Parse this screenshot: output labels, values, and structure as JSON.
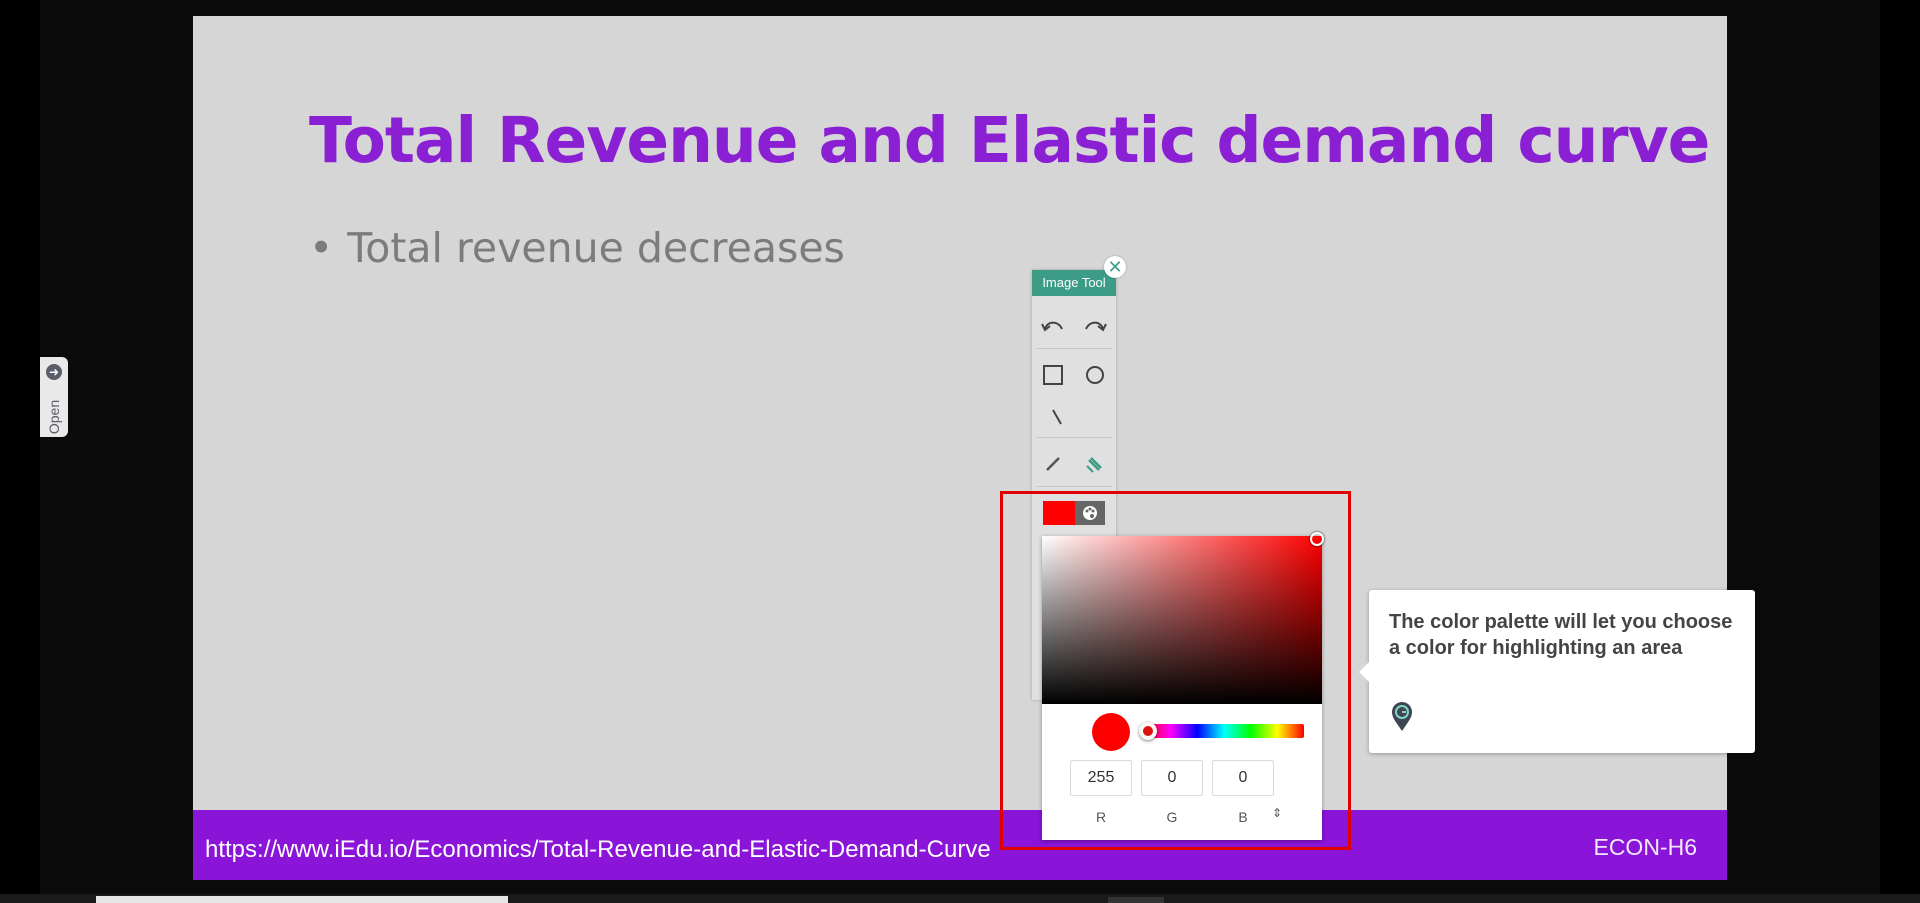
{
  "slide": {
    "title": "Total Revenue and Elastic demand curve",
    "bullet_mark": "•",
    "bullet": "Total revenue decreases",
    "footer_url": "https://www.iEdu.io/Economics/Total-Revenue-and-Elastic-Demand-Curve",
    "footer_code": "ECON-H6"
  },
  "sidebar": {
    "open_label": "Open",
    "open_icon": "arrow-right-icon"
  },
  "image_tool": {
    "title": "Image Tool",
    "close_icon": "close-icon",
    "tools": [
      "undo-icon",
      "redo-icon",
      "rectangle-icon",
      "circle-icon",
      "line-icon",
      "pen-icon",
      "highlighter-icon",
      "palette-icon"
    ],
    "selected_color": "#ff0000"
  },
  "color_picker": {
    "r": "255",
    "g": "0",
    "b": "0",
    "r_label": "R",
    "g_label": "G",
    "b_label": "B",
    "mode_toggle": "⇕"
  },
  "tooltip": {
    "text": "The color palette will let you choose a color for highlighting an area",
    "icon": "guide-pin-icon"
  },
  "colors": {
    "title": "#8a1fd4",
    "footer": "#8a14d8",
    "tool_header": "#3d9c86",
    "highlight": "#e00000"
  }
}
